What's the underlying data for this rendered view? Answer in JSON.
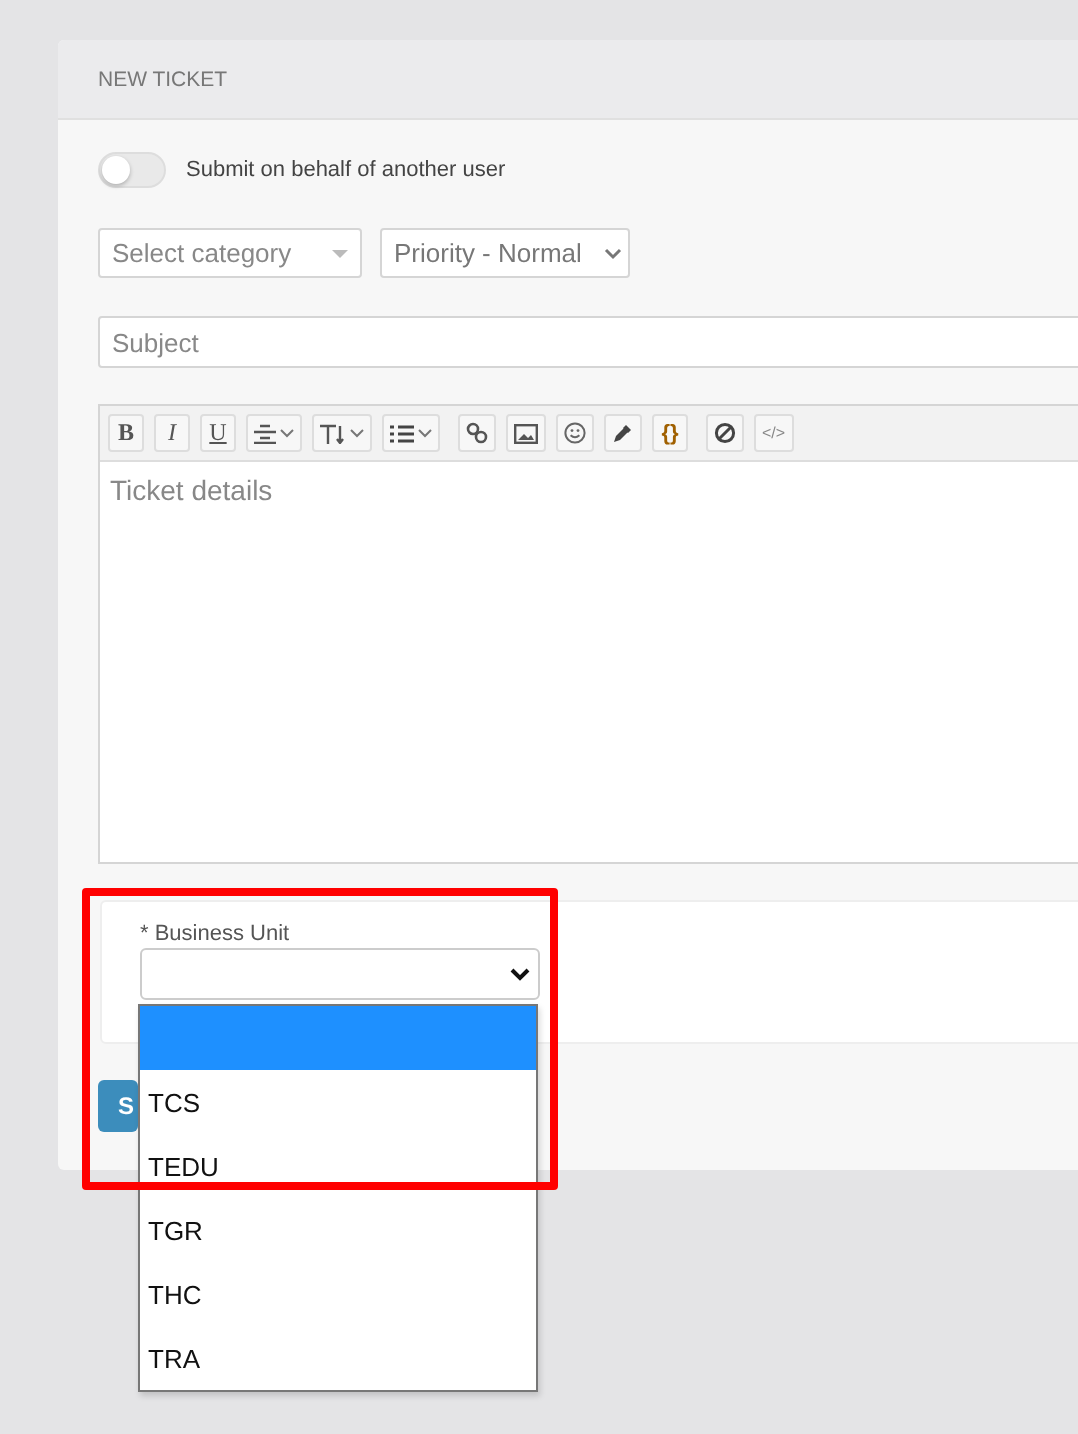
{
  "card": {
    "title": "NEW TICKET"
  },
  "behalf_toggle": {
    "on": false,
    "label": "Submit on behalf of another user"
  },
  "category_select": {
    "placeholder": "Select category"
  },
  "priority_select": {
    "value": "Priority - Normal"
  },
  "subject": {
    "placeholder": "Subject"
  },
  "toolbar": [
    [
      {
        "kind": "bold",
        "label": "B"
      },
      {
        "kind": "italic",
        "label": "I"
      },
      {
        "kind": "underline",
        "label": "U"
      },
      {
        "kind": "align",
        "has_menu": true
      },
      {
        "kind": "textsize",
        "has_menu": true
      },
      {
        "kind": "list",
        "has_menu": true
      }
    ],
    [
      {
        "kind": "link"
      },
      {
        "kind": "image"
      },
      {
        "kind": "emoji"
      },
      {
        "kind": "dropper"
      },
      {
        "kind": "code",
        "label": "{}"
      }
    ],
    [
      {
        "kind": "clear"
      },
      {
        "kind": "source",
        "label": "</>"
      }
    ]
  ],
  "details": {
    "placeholder": "Ticket details"
  },
  "business_unit": {
    "label": "* Business Unit",
    "options": [
      {
        "selected": true
      },
      {
        "label": "TCS",
        "selected": false
      },
      {
        "label": "TEDU",
        "selected": false
      },
      {
        "label": "TGR",
        "selected": false
      },
      {
        "label": "THC",
        "selected": false
      },
      {
        "label": "TRA",
        "selected": false
      }
    ]
  },
  "submit_button": {
    "label": "S"
  },
  "highlight": {
    "on": true
  }
}
